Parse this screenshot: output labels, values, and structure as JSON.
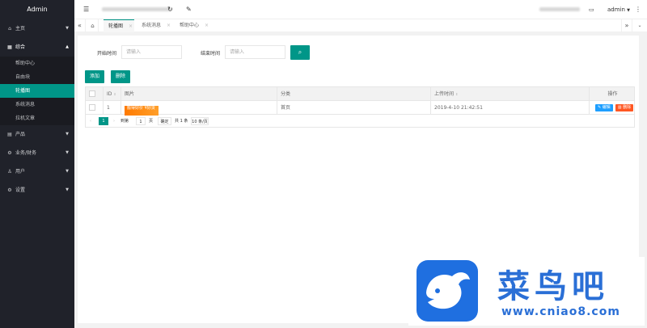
{
  "app": {
    "title": "Admin"
  },
  "sidebar": {
    "groups": [
      {
        "label": "主页",
        "icon": "home-icon",
        "expanded": false
      },
      {
        "label": "综合",
        "icon": "grid-icon",
        "expanded": true,
        "items": [
          "帮助中心",
          "自由块",
          "轮播图",
          "系统消息",
          "拉机文章"
        ],
        "selected": "轮播图"
      },
      {
        "label": "产品",
        "icon": "document-icon",
        "expanded": false
      },
      {
        "label": "业务/财务",
        "icon": "gear-icon",
        "expanded": false
      },
      {
        "label": "用户",
        "icon": "user-icon",
        "expanded": false
      },
      {
        "label": "设置",
        "icon": "settings-icon",
        "expanded": false
      }
    ]
  },
  "header": {
    "username": "admin"
  },
  "tabs": [
    {
      "label": "轮播图",
      "active": true
    },
    {
      "label": "系统消息",
      "active": false
    },
    {
      "label": "帮助中心",
      "active": false
    }
  ],
  "filters": {
    "start_label": "开始时间",
    "start_placeholder": "请输入",
    "end_label": "结束时间",
    "end_placeholder": "请输入"
  },
  "toolbar": {
    "add_label": "添加",
    "delete_label": "删除"
  },
  "table": {
    "columns": [
      "ID",
      "图片",
      "分类",
      "上传时间",
      "操作"
    ],
    "rows": [
      {
        "id": "1",
        "image_text": "搬得好价 ¥好货",
        "category": "首页",
        "uploaded": "2019-4-10 21:42:51",
        "edit_label": "编辑",
        "delete_label": "删除"
      }
    ]
  },
  "pagination": {
    "current": "1",
    "goto_label": "到第",
    "page_input": "1",
    "page_suffix": "页",
    "confirm_label": "确定",
    "total_label": "共 1 条",
    "per_page": "10 条/页"
  },
  "watermark": {
    "title": "菜鸟吧",
    "url": "www.cniao8.com"
  },
  "colors": {
    "accent": "#009688",
    "sidebar_bg": "#20222a",
    "edit": "#1e9fff",
    "delete": "#ff5722",
    "watermark": "#2a6fd6"
  }
}
